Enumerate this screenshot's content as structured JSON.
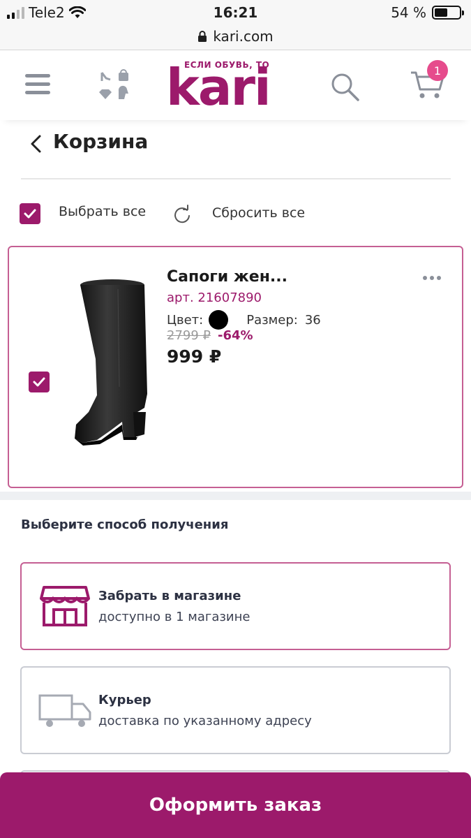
{
  "status_bar": {
    "carrier": "Tele2",
    "time": "16:21",
    "battery_text": "54 %",
    "battery_level": 0.54
  },
  "browser": {
    "url": "kari.com"
  },
  "header": {
    "logo_tagline": "ЕСЛИ ОБУВЬ, ТО",
    "logo_text": "kari",
    "cart_count": "1",
    "brand_color": "#9c1a6b",
    "badge_color": "#e64b8c",
    "icons": [
      "menu-icon",
      "categories-icon",
      "search-icon",
      "cart-icon"
    ]
  },
  "page": {
    "title": "Корзина",
    "select_all_label": "Выбрать все",
    "select_all_checked": true,
    "reset_label": "Сбросить все"
  },
  "cart_item": {
    "name": "Сапоги жен...",
    "article": "арт. 21607890",
    "color_label": "Цвет:",
    "color_value": "#000000",
    "size_label": "Размер:",
    "size_value": "36",
    "old_price": "2799 ₽",
    "discount": "-64%",
    "price": "999 ₽",
    "checked": true
  },
  "delivery": {
    "title": "Выберите способ получения",
    "options": [
      {
        "title": "Забрать в магазине",
        "subtitle": "доступно в 1 магазине",
        "icon": "store-icon",
        "selected": true
      },
      {
        "title": "Курьер",
        "subtitle": "доставка по указанному адресу",
        "icon": "truck-icon",
        "selected": false
      }
    ]
  },
  "checkout": {
    "label": "Оформить заказ"
  }
}
